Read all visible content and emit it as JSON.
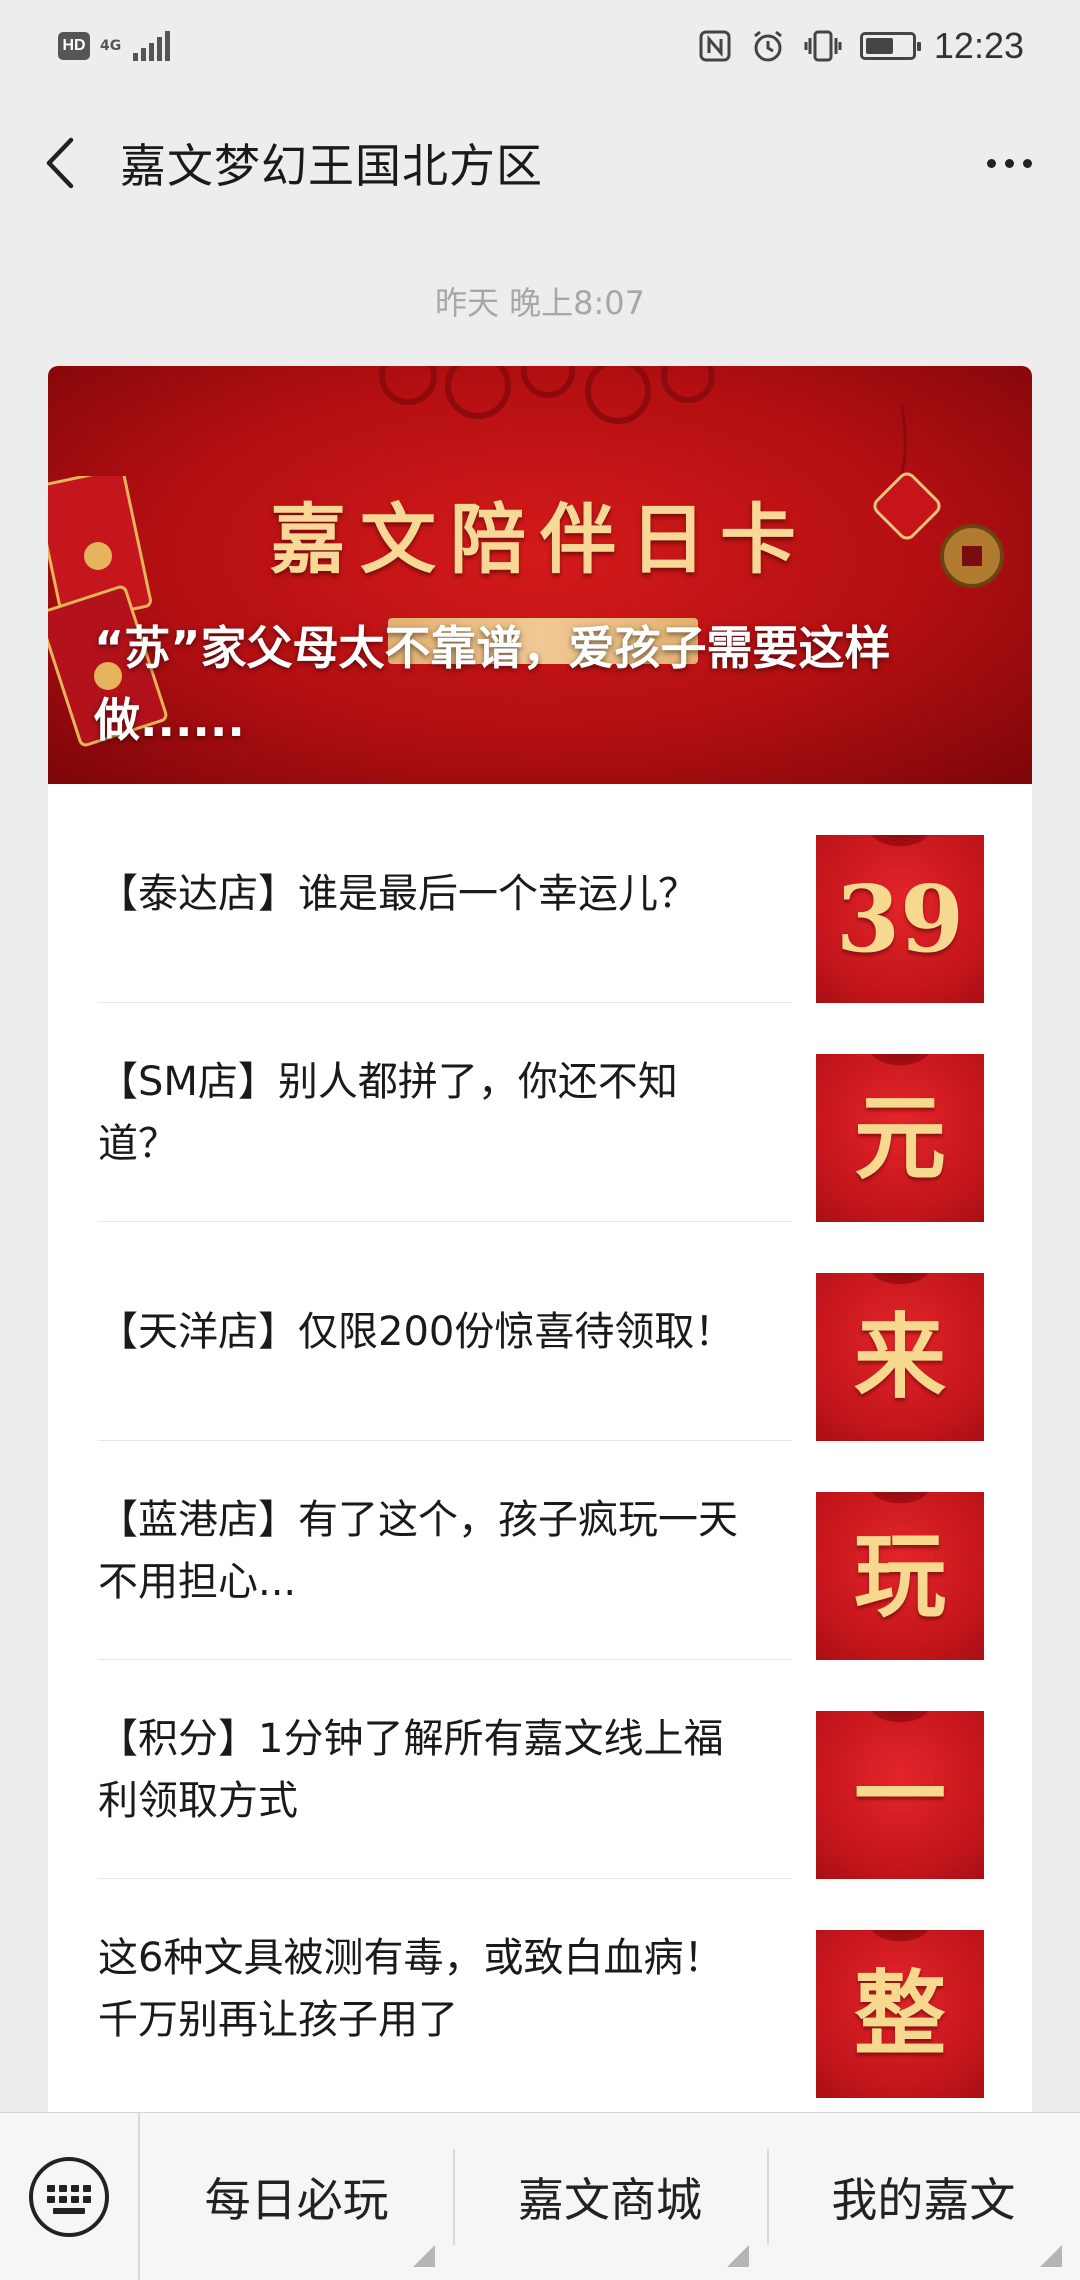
{
  "status_bar": {
    "hd": "HD",
    "network": "4G",
    "time": "12:23",
    "battery_level": 0.55
  },
  "header": {
    "title": "嘉文梦幻王国北方区"
  },
  "message_time": "昨天 晚上8:07",
  "cover": {
    "heading": "嘉文陪伴日卡",
    "title": "“苏”家父母太不靠谱，爱孩子需要这样做......"
  },
  "articles": [
    {
      "title": "【泰达店】谁是最后一个幸运儿？",
      "thumb": "39"
    },
    {
      "title": "【SM店】别人都拼了，你还不知道？",
      "thumb": "元"
    },
    {
      "title": "【天洋店】仅限200份惊喜待领取！",
      "thumb": "来"
    },
    {
      "title": "【蓝港店】有了这个，孩子疯玩一天不用担心...",
      "thumb": "玩"
    },
    {
      "title": "【积分】1分钟了解所有嘉文线上福利领取方式",
      "thumb": "一"
    },
    {
      "title": "这6种文具被测有毒，或致白血病！千万别再让孩子用了",
      "thumb": "整"
    }
  ],
  "bottom_menu": {
    "tabs": [
      "每日必玩",
      "嘉文商城",
      "我的嘉文"
    ]
  },
  "colors": {
    "background": "#ededed",
    "cover_red": "#c2151b",
    "gold": "#f6d98f"
  }
}
